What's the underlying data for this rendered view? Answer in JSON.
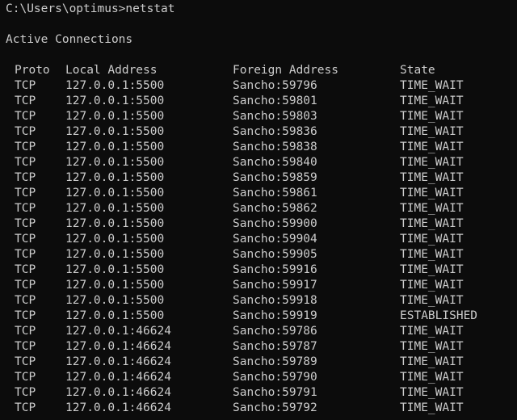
{
  "terminal": {
    "prompt_line": "C:\\Users\\optimus>netstat",
    "section_title": "Active Connections",
    "columns": {
      "proto": "Proto",
      "local": "Local Address",
      "foreign": "Foreign Address",
      "state": "State"
    },
    "rows": [
      {
        "proto": "TCP",
        "local": "127.0.0.1:5500",
        "foreign": "Sancho:59796",
        "state": "TIME_WAIT"
      },
      {
        "proto": "TCP",
        "local": "127.0.0.1:5500",
        "foreign": "Sancho:59801",
        "state": "TIME_WAIT"
      },
      {
        "proto": "TCP",
        "local": "127.0.0.1:5500",
        "foreign": "Sancho:59803",
        "state": "TIME_WAIT"
      },
      {
        "proto": "TCP",
        "local": "127.0.0.1:5500",
        "foreign": "Sancho:59836",
        "state": "TIME_WAIT"
      },
      {
        "proto": "TCP",
        "local": "127.0.0.1:5500",
        "foreign": "Sancho:59838",
        "state": "TIME_WAIT"
      },
      {
        "proto": "TCP",
        "local": "127.0.0.1:5500",
        "foreign": "Sancho:59840",
        "state": "TIME_WAIT"
      },
      {
        "proto": "TCP",
        "local": "127.0.0.1:5500",
        "foreign": "Sancho:59859",
        "state": "TIME_WAIT"
      },
      {
        "proto": "TCP",
        "local": "127.0.0.1:5500",
        "foreign": "Sancho:59861",
        "state": "TIME_WAIT"
      },
      {
        "proto": "TCP",
        "local": "127.0.0.1:5500",
        "foreign": "Sancho:59862",
        "state": "TIME_WAIT"
      },
      {
        "proto": "TCP",
        "local": "127.0.0.1:5500",
        "foreign": "Sancho:59900",
        "state": "TIME_WAIT"
      },
      {
        "proto": "TCP",
        "local": "127.0.0.1:5500",
        "foreign": "Sancho:59904",
        "state": "TIME_WAIT"
      },
      {
        "proto": "TCP",
        "local": "127.0.0.1:5500",
        "foreign": "Sancho:59905",
        "state": "TIME_WAIT"
      },
      {
        "proto": "TCP",
        "local": "127.0.0.1:5500",
        "foreign": "Sancho:59916",
        "state": "TIME_WAIT"
      },
      {
        "proto": "TCP",
        "local": "127.0.0.1:5500",
        "foreign": "Sancho:59917",
        "state": "TIME_WAIT"
      },
      {
        "proto": "TCP",
        "local": "127.0.0.1:5500",
        "foreign": "Sancho:59918",
        "state": "TIME_WAIT"
      },
      {
        "proto": "TCP",
        "local": "127.0.0.1:5500",
        "foreign": "Sancho:59919",
        "state": "ESTABLISHED"
      },
      {
        "proto": "TCP",
        "local": "127.0.0.1:46624",
        "foreign": "Sancho:59786",
        "state": "TIME_WAIT"
      },
      {
        "proto": "TCP",
        "local": "127.0.0.1:46624",
        "foreign": "Sancho:59787",
        "state": "TIME_WAIT"
      },
      {
        "proto": "TCP",
        "local": "127.0.0.1:46624",
        "foreign": "Sancho:59789",
        "state": "TIME_WAIT"
      },
      {
        "proto": "TCP",
        "local": "127.0.0.1:46624",
        "foreign": "Sancho:59790",
        "state": "TIME_WAIT"
      },
      {
        "proto": "TCP",
        "local": "127.0.0.1:46624",
        "foreign": "Sancho:59791",
        "state": "TIME_WAIT"
      },
      {
        "proto": "TCP",
        "local": "127.0.0.1:46624",
        "foreign": "Sancho:59792",
        "state": "TIME_WAIT"
      }
    ]
  },
  "colors": {
    "background": "#0c0c0c",
    "text": "#cccccc"
  }
}
